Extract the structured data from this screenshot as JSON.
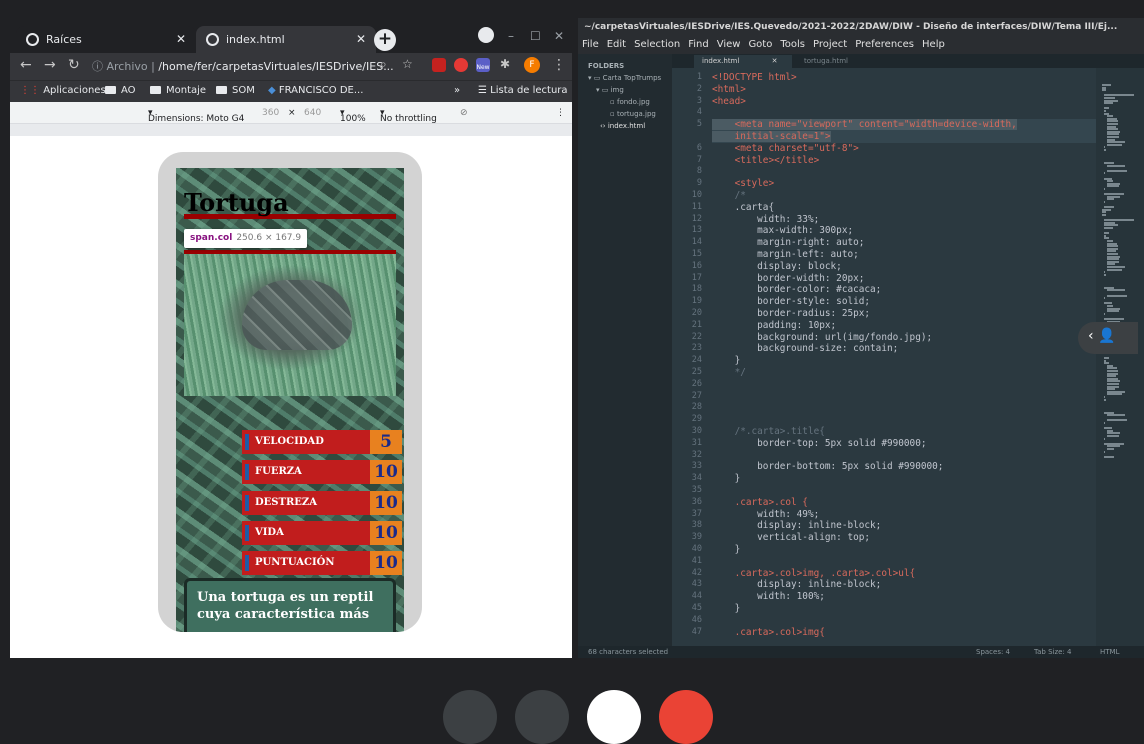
{
  "browser": {
    "tabs": [
      {
        "label": "Raíces",
        "active": false
      },
      {
        "label": "index.html",
        "active": true
      }
    ],
    "address": {
      "scheme": "Archivo",
      "path": "/home/fer/carpetasVirtuales/IESDrive/IES..."
    },
    "bookmarks": [
      "Aplicaciones",
      "AO",
      "Montaje",
      "SOM",
      "FRANCISCO DE...",
      "Lista de lectura"
    ],
    "device_toolbar": {
      "device": "Dimensions: Moto G4",
      "width": "360",
      "height": "640",
      "times": "×",
      "zoom": "100%",
      "throttle": "No throttling"
    },
    "extension_badge": "New",
    "profile_letter": "F"
  },
  "card": {
    "title": "Tortuga",
    "tooltip": {
      "selector": "span.col",
      "size": "250.6 × 167.9"
    },
    "stats": [
      {
        "label": "VELOCIDAD",
        "value": "5"
      },
      {
        "label": "FUERZA",
        "value": "10"
      },
      {
        "label": "DESTREZA",
        "value": "10"
      },
      {
        "label": "VIDA",
        "value": "10"
      },
      {
        "label": "PUNTUACIÓN",
        "value": "10"
      }
    ],
    "description": "Una tortuga es un reptil cuya característica más"
  },
  "editor": {
    "title": "~/carpetasVirtuales/IESDrive/IES.Quevedo/2021-2022/2DAW/DIW - Diseño de interfaces/DIW/Tema III/Ej...",
    "menu": [
      "File",
      "Edit",
      "Selection",
      "Find",
      "View",
      "Goto",
      "Tools",
      "Project",
      "Preferences",
      "Help"
    ],
    "sidebar": {
      "header": "FOLDERS",
      "items": [
        "Carta TopTrumps",
        "img",
        "fondo.jpg",
        "tortuga.jpg",
        "index.html"
      ]
    },
    "tabs": [
      "index.html",
      "tortuga.html"
    ],
    "code": [
      {
        "n": "1",
        "t": "<!DOCTYPE html>"
      },
      {
        "n": "2",
        "t": "<html>"
      },
      {
        "n": "3",
        "t": "<head>"
      },
      {
        "n": "4",
        "t": ""
      },
      {
        "n": "5",
        "t": "    <meta name=\"viewport\" content=\"width=device-width,"
      },
      {
        "n": "",
        "t": "    initial-scale=1\">"
      },
      {
        "n": "6",
        "t": "    <meta charset=\"utf-8\">"
      },
      {
        "n": "7",
        "t": "    <title></title>"
      },
      {
        "n": "8",
        "t": ""
      },
      {
        "n": "9",
        "t": "    <style>"
      },
      {
        "n": "10",
        "t": "    /*"
      },
      {
        "n": "11",
        "t": "    .carta{"
      },
      {
        "n": "12",
        "t": "        width: 33%;"
      },
      {
        "n": "13",
        "t": "        max-width: 300px;"
      },
      {
        "n": "14",
        "t": "        margin-right: auto;"
      },
      {
        "n": "15",
        "t": "        margin-left: auto;"
      },
      {
        "n": "16",
        "t": "        display: block;"
      },
      {
        "n": "17",
        "t": "        border-width: 20px;"
      },
      {
        "n": "18",
        "t": "        border-color: #cacaca;"
      },
      {
        "n": "19",
        "t": "        border-style: solid;"
      },
      {
        "n": "20",
        "t": "        border-radius: 25px;"
      },
      {
        "n": "21",
        "t": "        padding: 10px;"
      },
      {
        "n": "22",
        "t": "        background: url(img/fondo.jpg);"
      },
      {
        "n": "23",
        "t": "        background-size: contain;"
      },
      {
        "n": "24",
        "t": "    }"
      },
      {
        "n": "25",
        "t": "    */"
      },
      {
        "n": "26",
        "t": ""
      },
      {
        "n": "27",
        "t": ""
      },
      {
        "n": "28",
        "t": ""
      },
      {
        "n": "29",
        "t": ""
      },
      {
        "n": "30",
        "t": "    /*.carta>.title{"
      },
      {
        "n": "31",
        "t": "        border-top: 5px solid #990000;"
      },
      {
        "n": "32",
        "t": ""
      },
      {
        "n": "33",
        "t": "        border-bottom: 5px solid #990000;"
      },
      {
        "n": "34",
        "t": "    }"
      },
      {
        "n": "35",
        "t": ""
      },
      {
        "n": "36",
        "t": "    .carta>.col {"
      },
      {
        "n": "37",
        "t": "        width: 49%;"
      },
      {
        "n": "38",
        "t": "        display: inline-block;"
      },
      {
        "n": "39",
        "t": "        vertical-align: top;"
      },
      {
        "n": "40",
        "t": "    }"
      },
      {
        "n": "41",
        "t": ""
      },
      {
        "n": "42",
        "t": "    .carta>.col>img, .carta>.col>ul{"
      },
      {
        "n": "43",
        "t": "        display: inline-block;"
      },
      {
        "n": "44",
        "t": "        width: 100%;"
      },
      {
        "n": "45",
        "t": "    }"
      },
      {
        "n": "46",
        "t": ""
      },
      {
        "n": "47",
        "t": "    .carta>.col>img{"
      }
    ],
    "status": {
      "left": "68 characters selected",
      "spaces": "Spaces: 4",
      "tab_size": "Tab Size: 4",
      "syntax": "HTML"
    }
  },
  "colors": {
    "accent_red": "#990000",
    "stat_red": "#c11d1d",
    "stat_orange": "#e8811f",
    "editor_bg": "#2b3940"
  }
}
